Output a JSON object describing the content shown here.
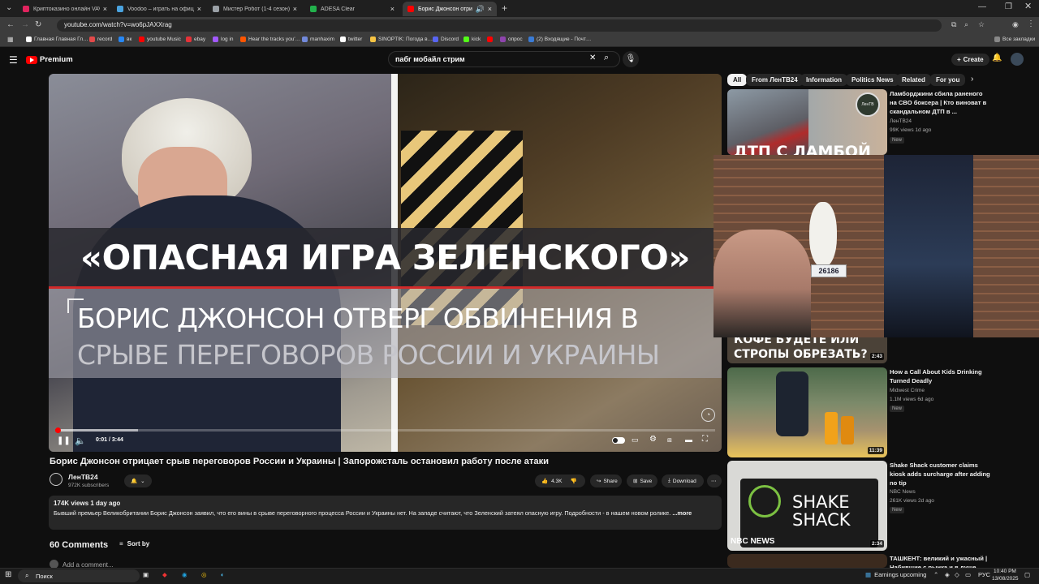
{
  "browser": {
    "tabs": [
      {
        "title": "Криптоказино онлайн VAVADA",
        "fav": "#e0245e"
      },
      {
        "title": "Voodoo – играть на официаль…",
        "fav": "#4aa3df"
      },
      {
        "title": "Мистер Робот (1-4 сезон) смотр…",
        "fav": "#9aa0a6"
      },
      {
        "title": "ADESA Clear",
        "fav": "#22b14c"
      },
      {
        "title": "Борис Джонсон отрицает",
        "fav": "#ff0000",
        "active": true
      }
    ],
    "url": "youtube.com/watch?v=wo6pJAXXrag",
    "bookmarks": [
      {
        "label": "Главная Главная Гл…",
        "color": "#ffffff"
      },
      {
        "label": "record",
        "color": "#e34a4a"
      },
      {
        "label": "вк",
        "color": "#2787f5"
      },
      {
        "label": "youtube Music",
        "color": "#ff0000"
      },
      {
        "label": "ebay",
        "color": "#e53238"
      },
      {
        "label": "log in",
        "color": "#a259ff"
      },
      {
        "label": "Hear the tracks you'…",
        "color": "#ff5500"
      },
      {
        "label": "manhaxim",
        "color": "#7289da"
      },
      {
        "label": "twitter",
        "color": "#ffffff"
      },
      {
        "label": "SINOPTIK: Погода в…",
        "color": "#f6c343"
      },
      {
        "label": "Discord",
        "color": "#5865f2"
      },
      {
        "label": "kick",
        "color": "#53fc18"
      },
      {
        "label": "",
        "color": "#ff0000"
      },
      {
        "label": "опрос",
        "color": "#8e44ad"
      },
      {
        "label": "(2) Входящие - Почт…",
        "color": "#3a7bd5"
      }
    ],
    "all_bookmarks": "Все закладки"
  },
  "youtube": {
    "logo": "Premium",
    "search_value": "пабг мобайл стрим",
    "create_label": "Create"
  },
  "video": {
    "headline": "«ОПАСНАЯ ИГРА ЗЕЛЕНСКОГО»",
    "subtitle_line1": "БОРИС ДЖОНСОН ОТВЕРГ ОБВИНЕНИЯ В",
    "subtitle_line2": "СРЫВЕ ПЕРЕГОВОРОВ РОССИИ И УКРАИНЫ",
    "time": "0:01 / 3:44",
    "progress_fraction": 0.004,
    "buffered_fraction": 0.125,
    "title": "Борис Джонсон отрицает срыв переговоров России и Украины | Запорожсталь остановил работу после атаки",
    "channel": "ЛенТВ24",
    "subscribers": "972K subscribers",
    "likes": "4.3K",
    "share": "Share",
    "save": "Save",
    "download": "Download",
    "meta": "174K views  1 day ago",
    "description": "Бывший премьер Великобритании Борис Джонсон заявил, что его вины в срыве переговорного процесса России и Украины нет. На западе считают, что Зеленский затеял опасную игру. Подробности - в нашем новом ролике.",
    "more": "...more",
    "comments_count": "60 Comments",
    "sort_by": "Sort by",
    "add_comment": "Add a comment..."
  },
  "chips": [
    "All",
    "From ЛенТВ24",
    "Information",
    "Politics News",
    "Related",
    "For you"
  ],
  "related": [
    {
      "title": "Ламборджини сбила раненого на СВО боксера | Кто виноват в скандальном ДТП в ...",
      "channel": "ЛенТВ24",
      "meta": "99K views  1d ago",
      "badge": "New",
      "thumb_text": "ДТП С ЛАМБОЙ"
    },
    {
      "title": "",
      "channel": "",
      "meta": "",
      "badge": "",
      "thumb_text": "КОФЕ БУДЕТЕ ИЛИ СТРОПЫ ОБРЕЗАТЬ?",
      "duration": "2:43"
    },
    {
      "title": "How a Call About Kids Drinking Turned Deadly",
      "channel": "Midwest Crime",
      "meta": "1.1M views  6d ago",
      "badge": "New",
      "duration": "11:39"
    },
    {
      "title": "Shake Shack customer claims kiosk adds surcharge after adding no tip",
      "channel": "NBC News",
      "meta": "261K views  2d ago",
      "badge": "New",
      "duration": "2:34",
      "thumb_text": "SHAKE SHACK",
      "thumb_logo": "NBC NEWS"
    },
    {
      "title": "ТАШКЕНТ: великий и ужасный | Набившие с рынка и в душе",
      "channel": "",
      "meta": "",
      "badge": ""
    }
  ],
  "webcam": {
    "plate": "26186"
  },
  "taskbar": {
    "search": "Поиск",
    "weather": "Earnings upcoming",
    "lang": "РУС",
    "time": "10:40 PM",
    "date": "13/08/2025"
  }
}
